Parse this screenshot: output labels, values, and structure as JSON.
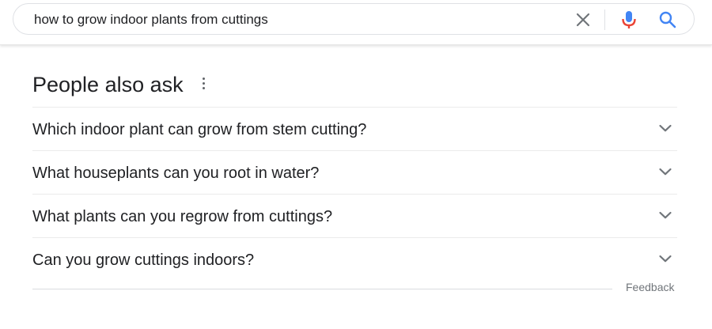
{
  "search": {
    "query": "how to grow indoor plants from cuttings",
    "clear_icon": "close-icon",
    "mic_icon": "microphone-icon",
    "search_icon": "search-icon",
    "colors": {
      "mic_blue": "#4285f4",
      "mic_red": "#ea4335",
      "search_blue": "#4285f4",
      "clear_gray": "#70757a"
    }
  },
  "people_also_ask": {
    "title": "People also ask",
    "menu_icon": "more-vert-icon",
    "questions": [
      {
        "text": "Which indoor plant can grow from stem cutting?",
        "icon": "chevron-down-icon"
      },
      {
        "text": "What houseplants can you root in water?",
        "icon": "chevron-down-icon"
      },
      {
        "text": "What plants can you regrow from cuttings?",
        "icon": "chevron-down-icon"
      },
      {
        "text": "Can you grow cuttings indoors?",
        "icon": "chevron-down-icon"
      }
    ]
  },
  "footer": {
    "feedback_label": "Feedback"
  }
}
